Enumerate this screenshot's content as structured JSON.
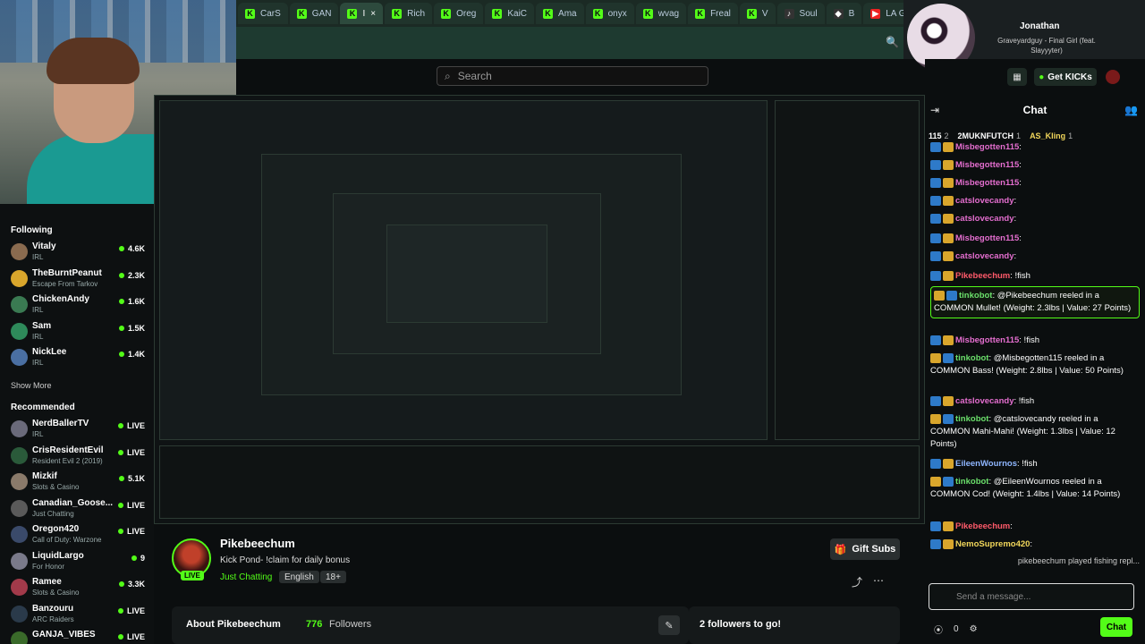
{
  "browser": {
    "tabs": [
      {
        "label": "CarS",
        "icon": "kick-icon"
      },
      {
        "label": "GAN",
        "icon": "kick-icon"
      },
      {
        "label": "I",
        "icon": "kick-icon",
        "active": true
      },
      {
        "label": "Rich",
        "icon": "kick-icon"
      },
      {
        "label": "Oreg",
        "icon": "kick-icon"
      },
      {
        "label": "KaiC",
        "icon": "kick-icon"
      },
      {
        "label": "Ama",
        "icon": "kick-icon"
      },
      {
        "label": "onyx",
        "icon": "kick-icon"
      },
      {
        "label": "wvag",
        "icon": "kick-icon"
      },
      {
        "label": "Freal",
        "icon": "kick-icon"
      },
      {
        "label": "V",
        "icon": "kick-icon"
      },
      {
        "label": "Soul",
        "icon": "speaker-icon"
      },
      {
        "label": "B",
        "icon": "diamond-icon"
      },
      {
        "label": "LA G",
        "icon": "youtube-icon"
      }
    ],
    "close_glyph": "×"
  },
  "header": {
    "search_placeholder": "Search",
    "get_kicks": "Get KICKs"
  },
  "now_playing": {
    "user": "Jonathan",
    "song": "Graveyardguy - Final Girl (feat. Slayyyter)"
  },
  "sidebar": {
    "following_title": "Following",
    "following": [
      {
        "name": "Vitaly",
        "sub": "IRL",
        "count": "4.6K",
        "color": "#8a6b4f"
      },
      {
        "name": "TheBurntPeanut",
        "sub": "Escape From Tarkov",
        "count": "2.3K",
        "color": "#d9a62c"
      },
      {
        "name": "ChickenAndy",
        "sub": "IRL",
        "count": "1.6K",
        "color": "#3a7a52"
      },
      {
        "name": "Sam",
        "sub": "IRL",
        "count": "1.5K",
        "color": "#2e8a5a"
      },
      {
        "name": "NickLee",
        "sub": "IRL",
        "count": "1.4K",
        "color": "#4a6fa2"
      }
    ],
    "show_more": "Show More",
    "recommended_title": "Recommended",
    "recommended": [
      {
        "name": "NerdBallerTV",
        "sub": "IRL",
        "count": "LIVE",
        "color": "#6a6a7a"
      },
      {
        "name": "CrisResidentEvil",
        "sub": "Resident Evil 2 (2019)",
        "count": "LIVE",
        "color": "#2a5a3a"
      },
      {
        "name": "Mizkif",
        "sub": "Slots & Casino",
        "count": "5.1K",
        "color": "#8a7a6a"
      },
      {
        "name": "Canadian_Goose...",
        "sub": "Just Chatting",
        "count": "LIVE",
        "color": "#5a5a5a"
      },
      {
        "name": "Oregon420",
        "sub": "Call of Duty: Warzone",
        "count": "LIVE",
        "color": "#3a4a6a"
      },
      {
        "name": "LiquidLargo",
        "sub": "For Honor",
        "count": "9",
        "color": "#7a7a8a"
      },
      {
        "name": "Ramee",
        "sub": "Slots & Casino",
        "count": "3.3K",
        "color": "#a23a4a"
      },
      {
        "name": "Banzouru",
        "sub": "ARC Raiders",
        "count": "LIVE",
        "color": "#2a3a4a"
      },
      {
        "name": "GANJA_VIBES",
        "sub": "",
        "count": "LIVE",
        "color": "#3a6a2a"
      }
    ]
  },
  "stream": {
    "channel": "Pikebeechum",
    "title": "Kick Pond- !claim for daily bonus",
    "category": "Just Chatting",
    "tags": [
      "English",
      "18+"
    ],
    "live": "LIVE",
    "gift_subs": "Gift Subs",
    "about_title": "About Pikebeechum",
    "followers_count": "776",
    "followers_label": "Followers",
    "goal": "2 followers to go!"
  },
  "chat": {
    "title": "Chat",
    "gifters": [
      {
        "name": "115",
        "count": "2"
      },
      {
        "name": "2MUKNFUTCH",
        "count": "1"
      },
      {
        "name": "AS_Kling",
        "count": "1"
      }
    ],
    "messages": [
      {
        "user": "Misbegotten115",
        "text": ":",
        "cls": "u-pink"
      },
      {
        "user": "Misbegotten115",
        "text": ":",
        "cls": "u-pink"
      },
      {
        "user": "Misbegotten115",
        "text": ":",
        "cls": "u-pink"
      },
      {
        "user": "catslovecandy",
        "text": ":",
        "cls": "u-pink"
      },
      {
        "user": "catslovecandy",
        "text": ":",
        "cls": "u-pink"
      },
      {
        "user": "Misbegotten115",
        "text": ":",
        "cls": "u-pink"
      },
      {
        "user": "catslovecandy",
        "text": ":",
        "cls": "u-pink"
      },
      {
        "user": "Pikebeechum",
        "text": ": !fish",
        "cls": "u-red"
      },
      {
        "user": "tinkobot",
        "text": ": @Pikebeechum reeled in a COMMON Mullet! (Weight: 2.3lbs | Value: 27 Points)",
        "cls": "u-green"
      },
      {
        "user": "Misbegotten115",
        "text": ": !fish",
        "cls": "u-pink"
      },
      {
        "user": "tinkobot",
        "text": ": @Misbegotten115 reeled in a COMMON Bass! (Weight: 2.8lbs | Value: 50 Points)",
        "cls": "u-green"
      },
      {
        "user": "catslovecandy",
        "text": ": !fish",
        "cls": "u-pink"
      },
      {
        "user": "tinkobot",
        "text": ": @catslovecandy reeled in a COMMON Mahi-Mahi! (Weight: 1.3lbs | Value: 12 Points)",
        "cls": "u-green"
      },
      {
        "user": "EileenWournos",
        "text": ": !fish",
        "cls": "u-blue"
      },
      {
        "user": "tinkobot",
        "text": ": @EileenWournos reeled in a COMMON Cod! (Weight: 1.4lbs | Value: 14 Points)",
        "cls": "u-green"
      },
      {
        "user": "Pikebeechum",
        "text": ":",
        "cls": "u-red"
      },
      {
        "user": "NemoSupremo420",
        "text": ":",
        "cls": "u-yellow"
      }
    ],
    "overlay": "pikebeechum played fishing repl...",
    "input_placeholder": "Send a message...",
    "points": "0",
    "send": "Chat"
  }
}
